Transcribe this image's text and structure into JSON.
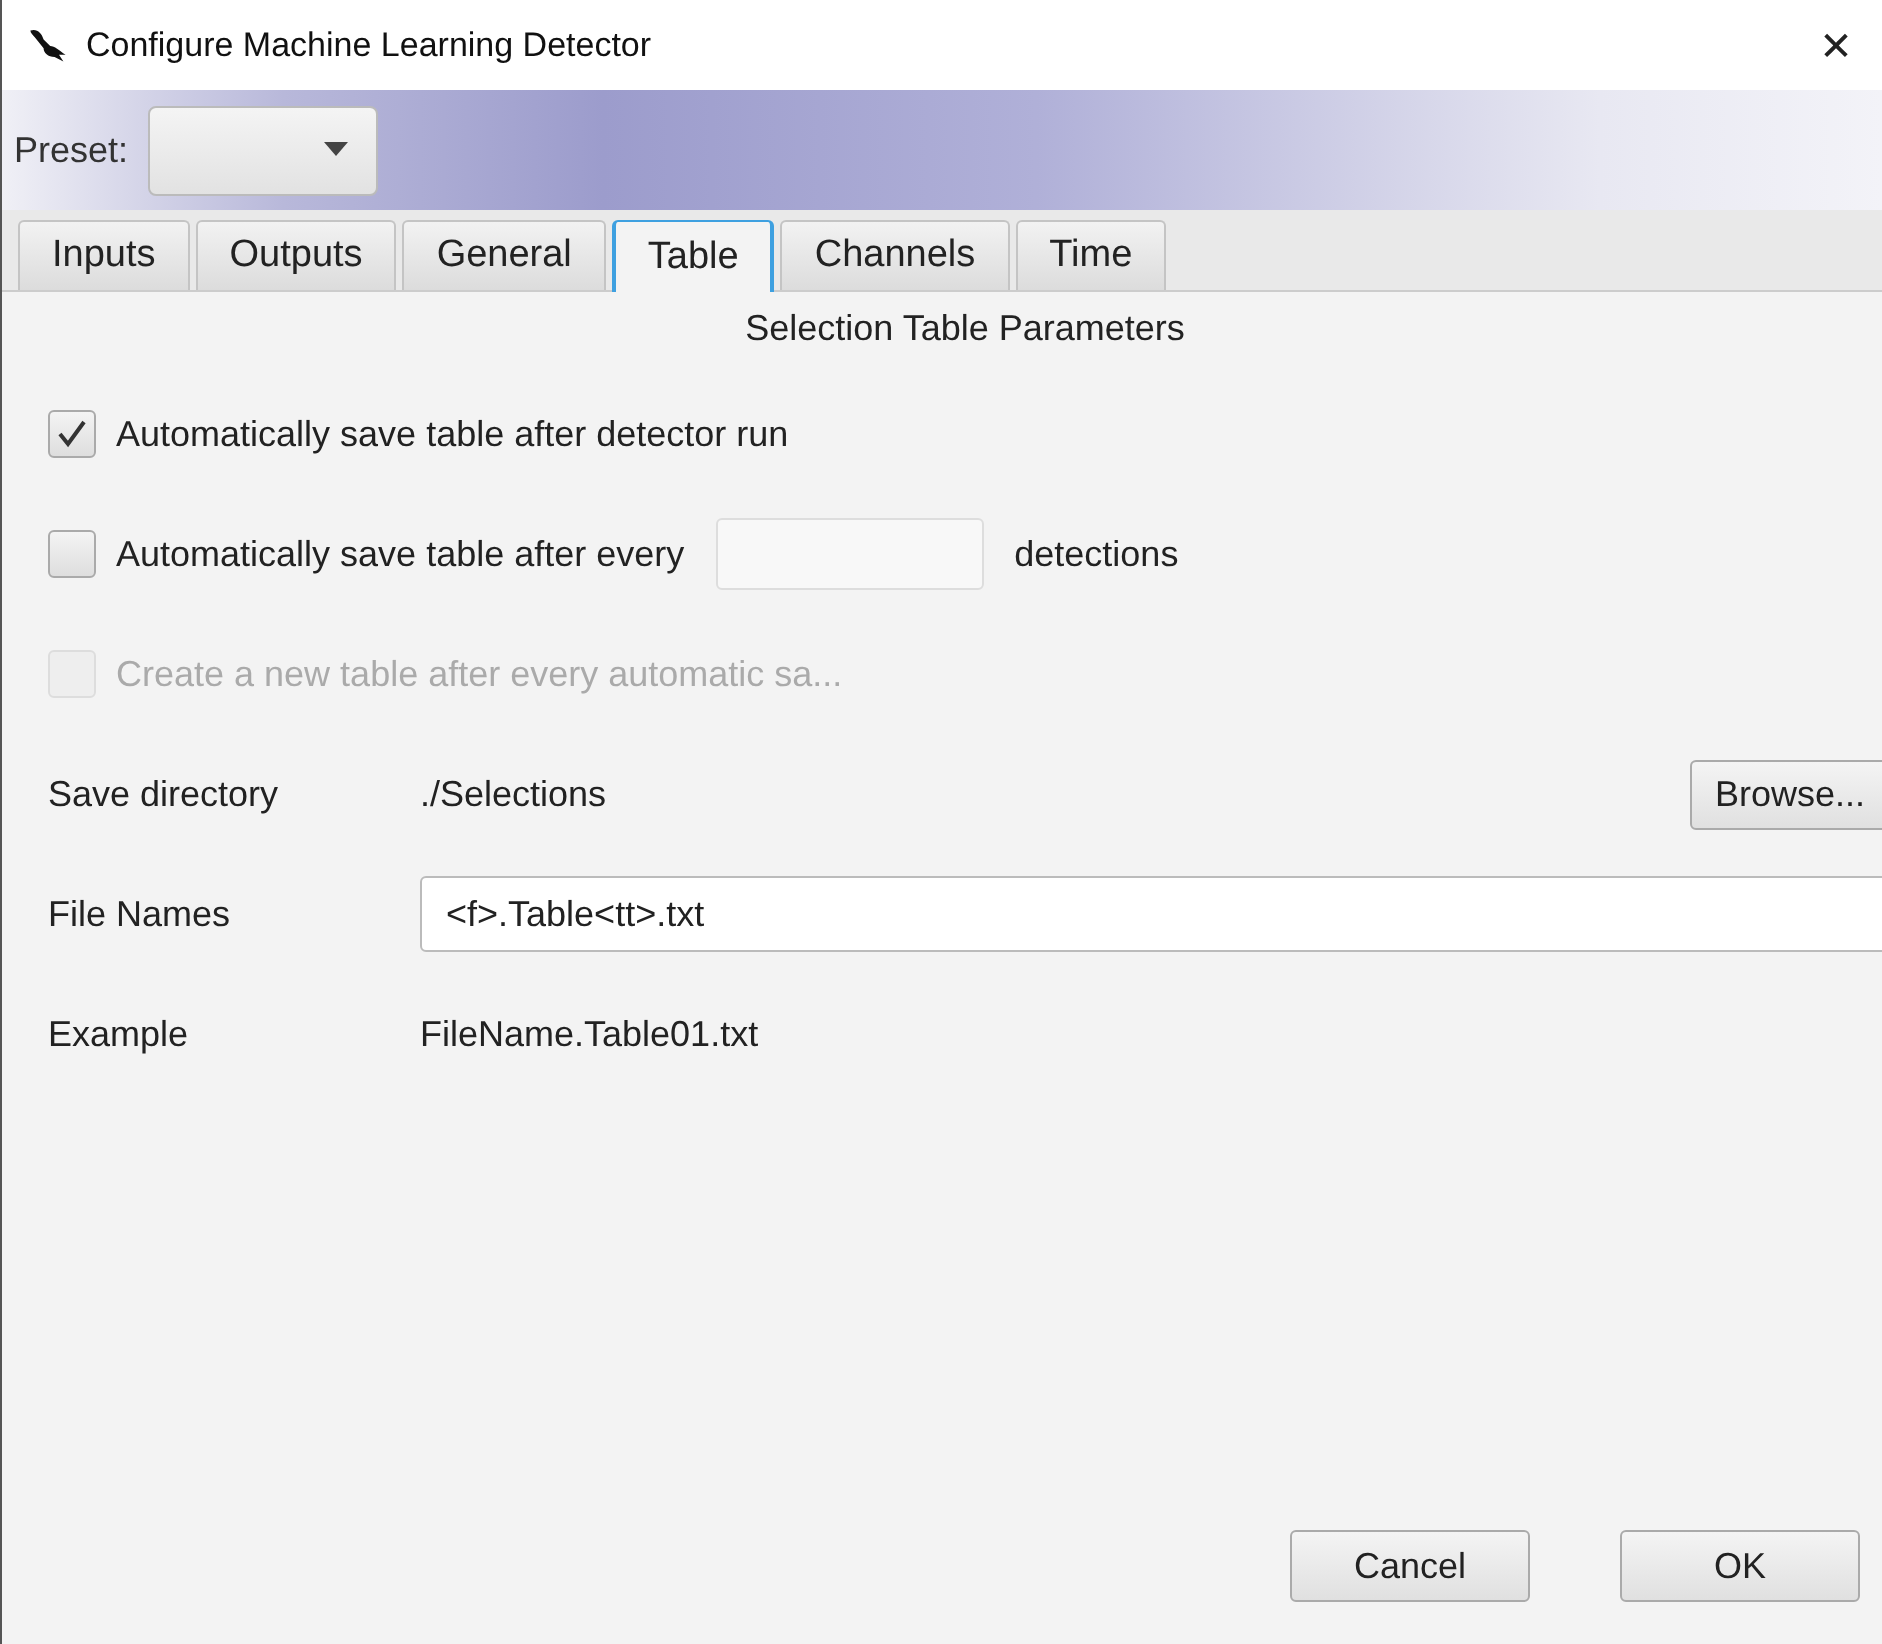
{
  "window": {
    "title": "Configure Machine Learning Detector",
    "close": "✕"
  },
  "preset": {
    "label": "Preset:"
  },
  "tabs": [
    {
      "label": "Inputs",
      "selected": false
    },
    {
      "label": "Outputs",
      "selected": false
    },
    {
      "label": "General",
      "selected": false
    },
    {
      "label": "Table",
      "selected": true
    },
    {
      "label": "Channels",
      "selected": false
    },
    {
      "label": "Time",
      "selected": false
    }
  ],
  "section_title": "Selection Table Parameters",
  "options": [
    {
      "kind": "checkbox",
      "label": "Automatically save table after detector run",
      "checked": true,
      "disabled": false
    },
    {
      "kind": "count",
      "label": "Automatically save table after every",
      "suffix": "detections",
      "checked": false,
      "disabled": false
    },
    {
      "kind": "checkbox",
      "label": "Create a new table after every automatic sa...",
      "checked": false,
      "disabled": true
    }
  ],
  "fields": [
    {
      "kind": "path",
      "label": "Save directory",
      "value": "./Selections",
      "button": "Browse..."
    },
    {
      "kind": "input",
      "label": "File Names",
      "value": "<f>.Table<tt>.txt"
    },
    {
      "kind": "text",
      "label": "Example",
      "value": "FileName.Table01.txt"
    }
  ],
  "buttons": [
    "Cancel",
    "OK"
  ]
}
